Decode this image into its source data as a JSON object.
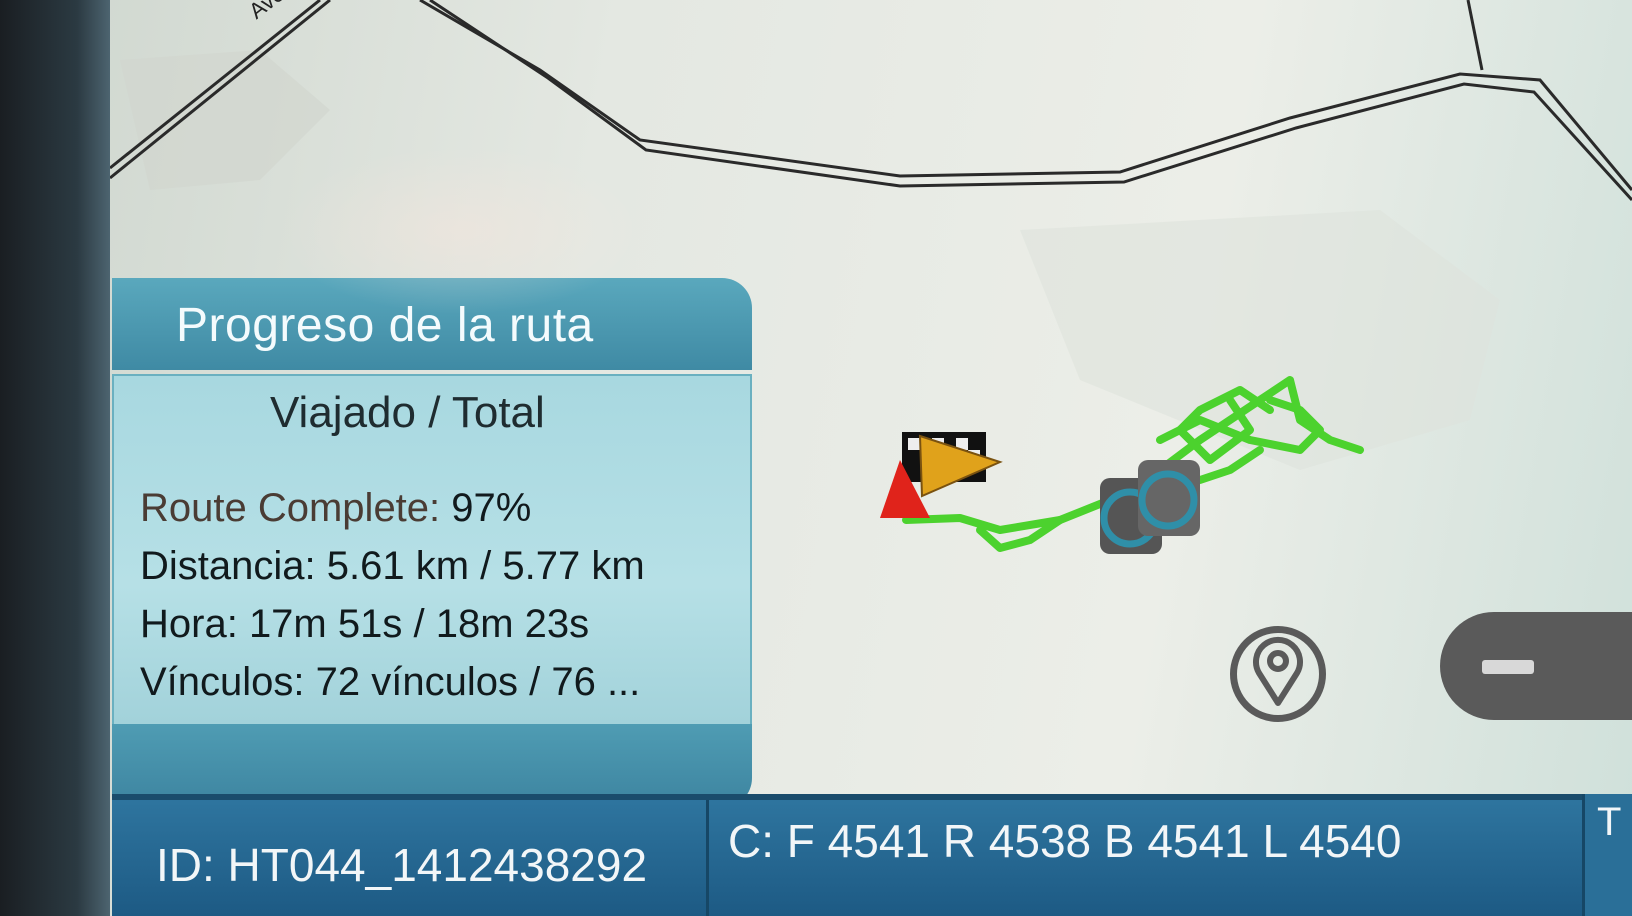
{
  "map": {
    "street_label": "Aven",
    "colors": {
      "background": "#e6eae4",
      "road": "#2a2a2a",
      "route_trace": "#4cd22e",
      "start_marker": "#e0231b",
      "vehicle_marker": "#e0a21b"
    },
    "icons": [
      "finish-flag-icon",
      "vehicle-arrow-icon",
      "start-cone-icon",
      "vehicle-cluster-icon",
      "location-pin-icon",
      "zoom-out-icon"
    ]
  },
  "progress_panel": {
    "title": "Progreso de la ruta",
    "column_header": "Viajado / Total",
    "route_complete": {
      "label": "Route Complete:",
      "value": "97%",
      "percent": 97
    },
    "distance": {
      "label": "Distancia:",
      "value": "5.61 km / 5.77 km"
    },
    "time": {
      "label": "Hora:",
      "value": "17m 51s / 18m 23s"
    },
    "links": {
      "label": "Vínculos:",
      "value": "72 vínculos / 76 ..."
    }
  },
  "status_bar": {
    "device_id": "ID: HT044_1412438292",
    "counts": "C: F 4541 R 4538 B 4541 L 4540",
    "edge_label": "T"
  },
  "colors": {
    "panel_header": "#4a98b0",
    "panel_body": "#aedbe2",
    "status_bar": "#2468928"
  }
}
